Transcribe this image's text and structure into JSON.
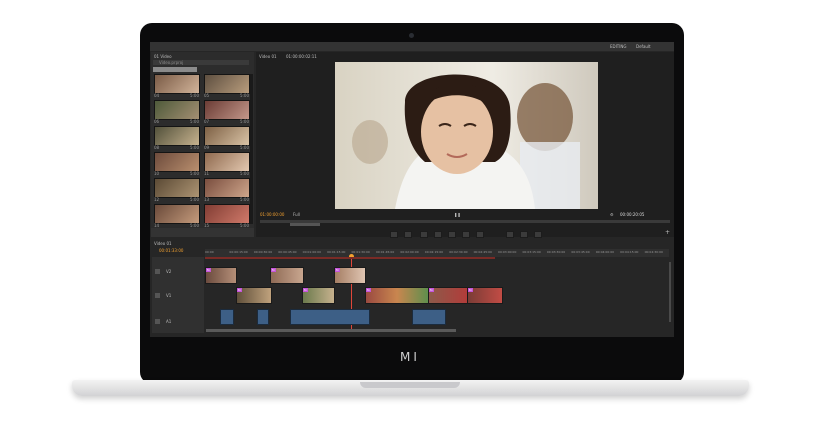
{
  "window": {
    "workspace_label": "EDITING",
    "workspace_preset": "Default"
  },
  "project_panel": {
    "tab_label": "01 Video",
    "search_placeholder": "Video.prproj",
    "clips": [
      {
        "name": "04",
        "duration": "5:00"
      },
      {
        "name": "05",
        "duration": "5:00"
      },
      {
        "name": "06",
        "duration": "5:00"
      },
      {
        "name": "07",
        "duration": "5:00"
      },
      {
        "name": "08",
        "duration": "5:00"
      },
      {
        "name": "09",
        "duration": "5:00"
      },
      {
        "name": "10",
        "duration": "5:00"
      },
      {
        "name": "11",
        "duration": "5:00"
      },
      {
        "name": "12",
        "duration": "5:00"
      },
      {
        "name": "13",
        "duration": "5:00"
      },
      {
        "name": "14",
        "duration": "5:00"
      },
      {
        "name": "15",
        "duration": "5:00"
      }
    ]
  },
  "program_monitor": {
    "tab_label": "Video 01",
    "timecode_tab": "01:00:00:02:11",
    "current_time": "01:00:00:00",
    "fit_label": "Full",
    "end_time": "00:00:20:05"
  },
  "timeline": {
    "tab_label": "Video 01",
    "current_time": "00:01:33:00",
    "ruler_marks": [
      "00:00",
      "00:00:15:00",
      "00:00:30:00",
      "00:00:45:00",
      "00:01:00:00",
      "00:01:15:00",
      "00:01:30:00",
      "00:01:45:00",
      "00:02:00:00",
      "00:02:15:00",
      "00:02:30:00",
      "00:02:45:00",
      "00:03:00:00",
      "00:03:15:00",
      "00:03:30:00",
      "00:03:45:00",
      "00:04:00:00",
      "00:04:15:00",
      "00:04:30:00"
    ],
    "tracks": [
      {
        "name": "V2"
      },
      {
        "name": "V1"
      },
      {
        "name": "A1"
      }
    ]
  },
  "laptop": {
    "brand": "MI"
  }
}
